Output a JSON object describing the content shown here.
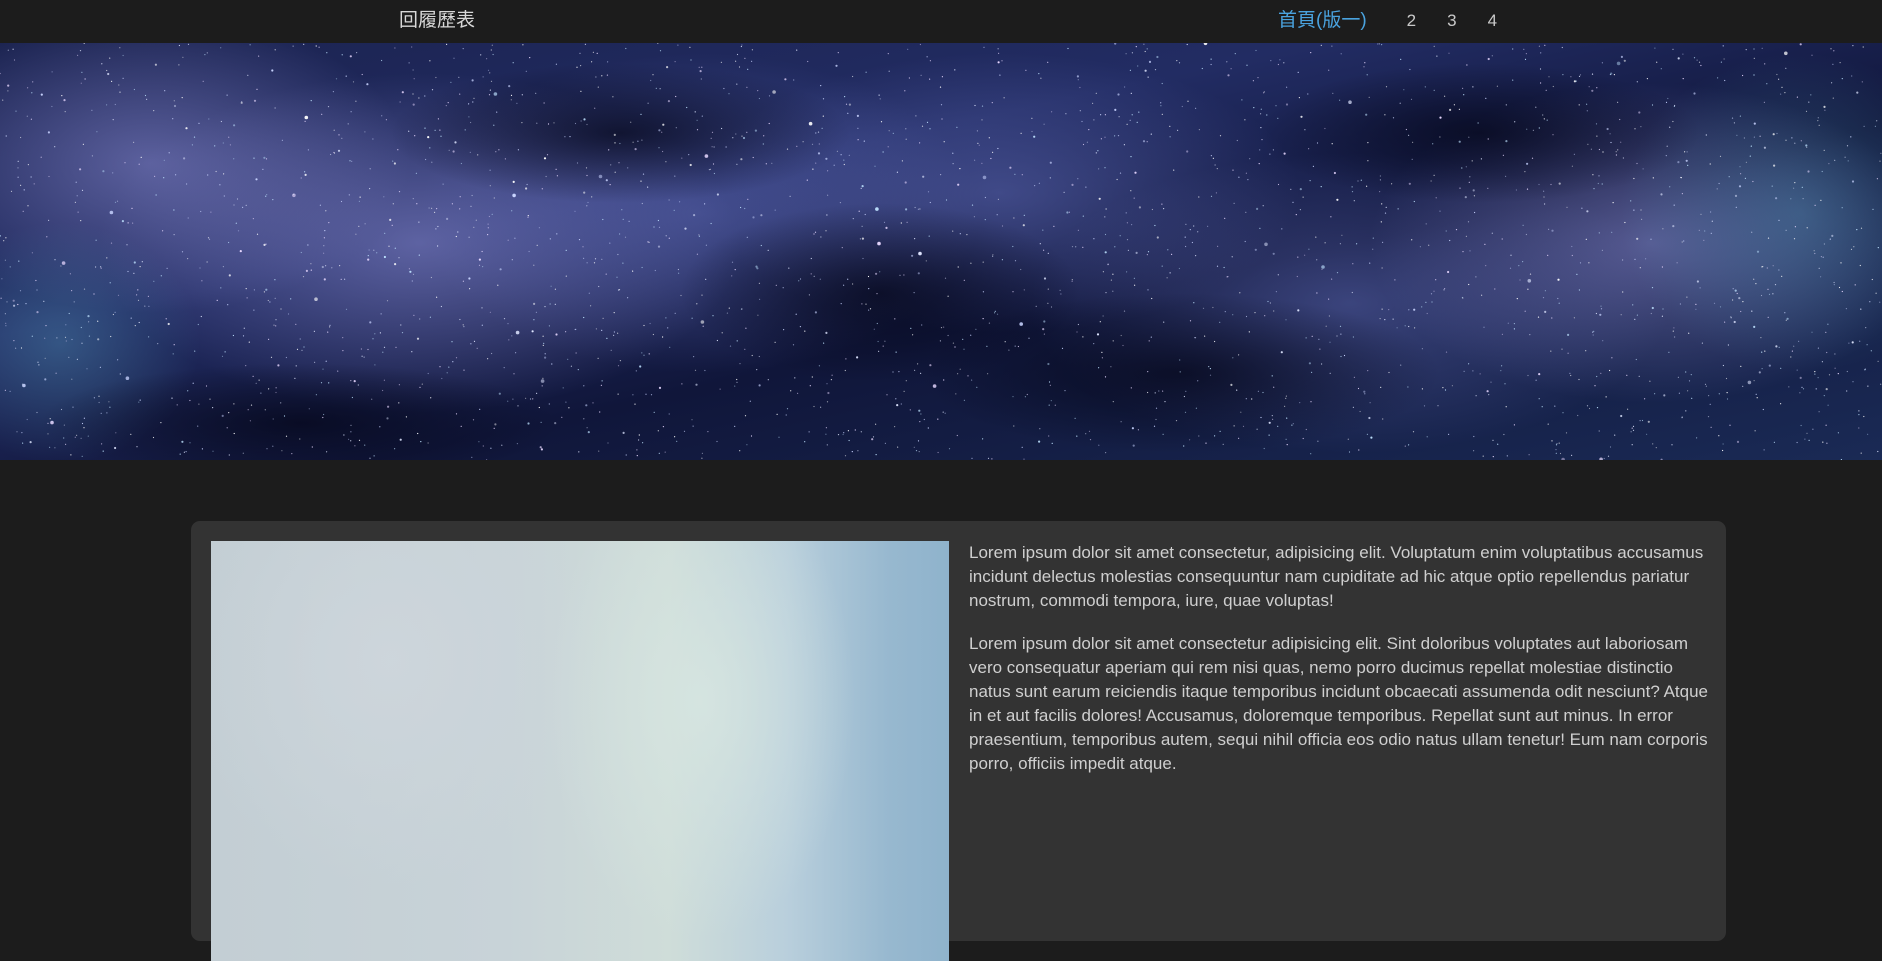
{
  "nav": {
    "brand": "回履歷表",
    "links": [
      {
        "label": "首頁(版一)",
        "active": true
      },
      {
        "label": "2",
        "active": false
      },
      {
        "label": "3",
        "active": false
      },
      {
        "label": "4",
        "active": false
      }
    ]
  },
  "colors": {
    "background": "#1c1c1c",
    "card": "#333333",
    "active_link": "#4aa3df",
    "text": "#cfcfcf"
  },
  "main": {
    "paragraphs": [
      "Lorem ipsum dolor sit amet consectetur, adipisicing elit. Voluptatum enim voluptatibus accusamus incidunt delectus molestias consequuntur nam cupiditate ad hic atque optio repellendus pariatur nostrum, commodi tempora, iure, quae voluptas!",
      "Lorem ipsum dolor sit amet consectetur adipisicing elit. Sint doloribus voluptates aut laboriosam vero consequatur aperiam qui rem nisi quas, nemo porro ducimus repellat molestiae distinctio natus sunt earum reiciendis itaque temporibus incidunt obcaecati assumenda odit nesciunt? Atque in et aut facilis dolores! Accusamus, doloremque temporibus. Repellat sunt aut minus. In error praesentium, temporibus autem, sequi nihil officia eos odio natus ullam tenetur! Eum nam corporis porro, officiis impedit atque."
    ]
  }
}
